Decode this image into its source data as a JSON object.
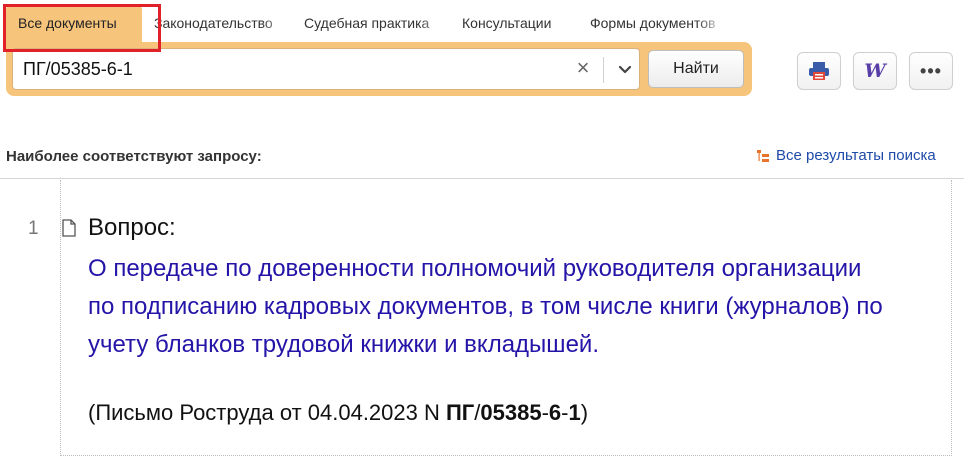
{
  "tabs": [
    {
      "label": "Все документы",
      "active": true
    },
    {
      "label": "Законодательство",
      "active": false
    },
    {
      "label": "Судебная практика",
      "active": false
    },
    {
      "label": "Консультации",
      "active": false
    },
    {
      "label": "Формы документов",
      "active": false
    }
  ],
  "search": {
    "value": "ПГ/05385-6-1",
    "find_label": "Найти"
  },
  "toolbar": {
    "print_icon": "printer-icon",
    "word_icon": "word-export-icon",
    "more_icon": "more-icon"
  },
  "results": {
    "heading": "Наиболее соответствуют запросу:",
    "all_results_label": "Все результаты поиска",
    "items": [
      {
        "number": "1",
        "label": "Вопрос:",
        "title": "О передаче по доверенности полномочий руководителя организации по подписанию кадровых документов, в том числе книги (журналов) по учету бланков трудовой книжки и вкладышей.",
        "source_prefix": "(Письмо Роструда от 04.04.2023 N ",
        "source_p1": "ПГ",
        "source_s1": "/",
        "source_p2": "05385",
        "source_s2": "-",
        "source_p3": "6",
        "source_s3": "-",
        "source_p4": "1",
        "source_suffix": ")"
      }
    ]
  },
  "colors": {
    "accent": "#f7c47c",
    "link": "#2414a8",
    "highlight": "#e0212a"
  }
}
